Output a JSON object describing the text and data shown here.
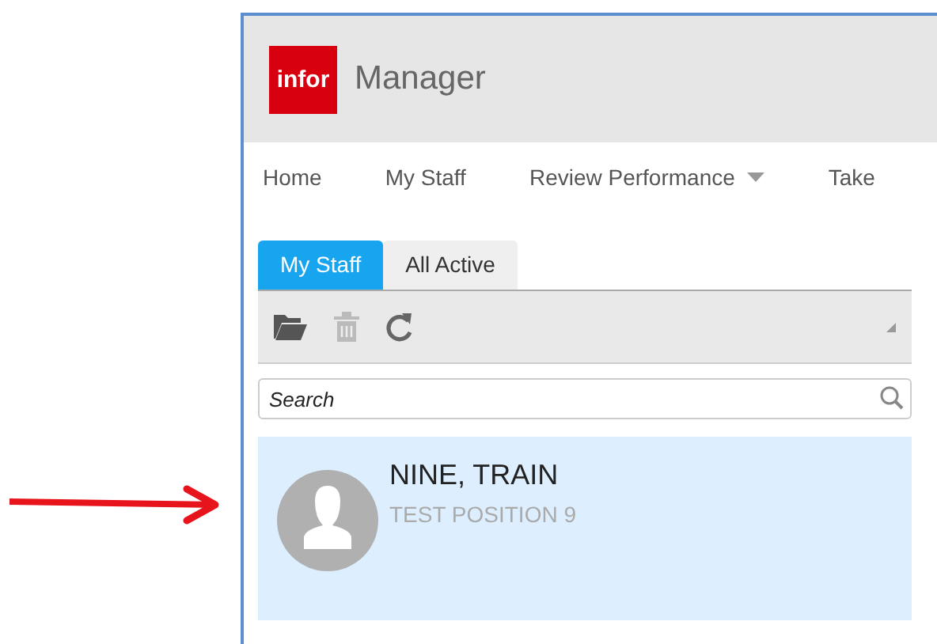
{
  "window": {
    "logo": "infor",
    "title": "Manager"
  },
  "nav": [
    {
      "label": "Home",
      "dropdown": false
    },
    {
      "label": "My Staff",
      "dropdown": false
    },
    {
      "label": "Review Performance",
      "dropdown": true
    },
    {
      "label": "Take",
      "dropdown": false
    }
  ],
  "tabs": [
    {
      "label": "My Staff",
      "selected": true
    },
    {
      "label": "All Active",
      "selected": false
    }
  ],
  "search": {
    "placeholder": "Search"
  },
  "staff": [
    {
      "name": "NINE, TRAIN",
      "position": "TEST POSITION 9",
      "selected": true
    }
  ]
}
